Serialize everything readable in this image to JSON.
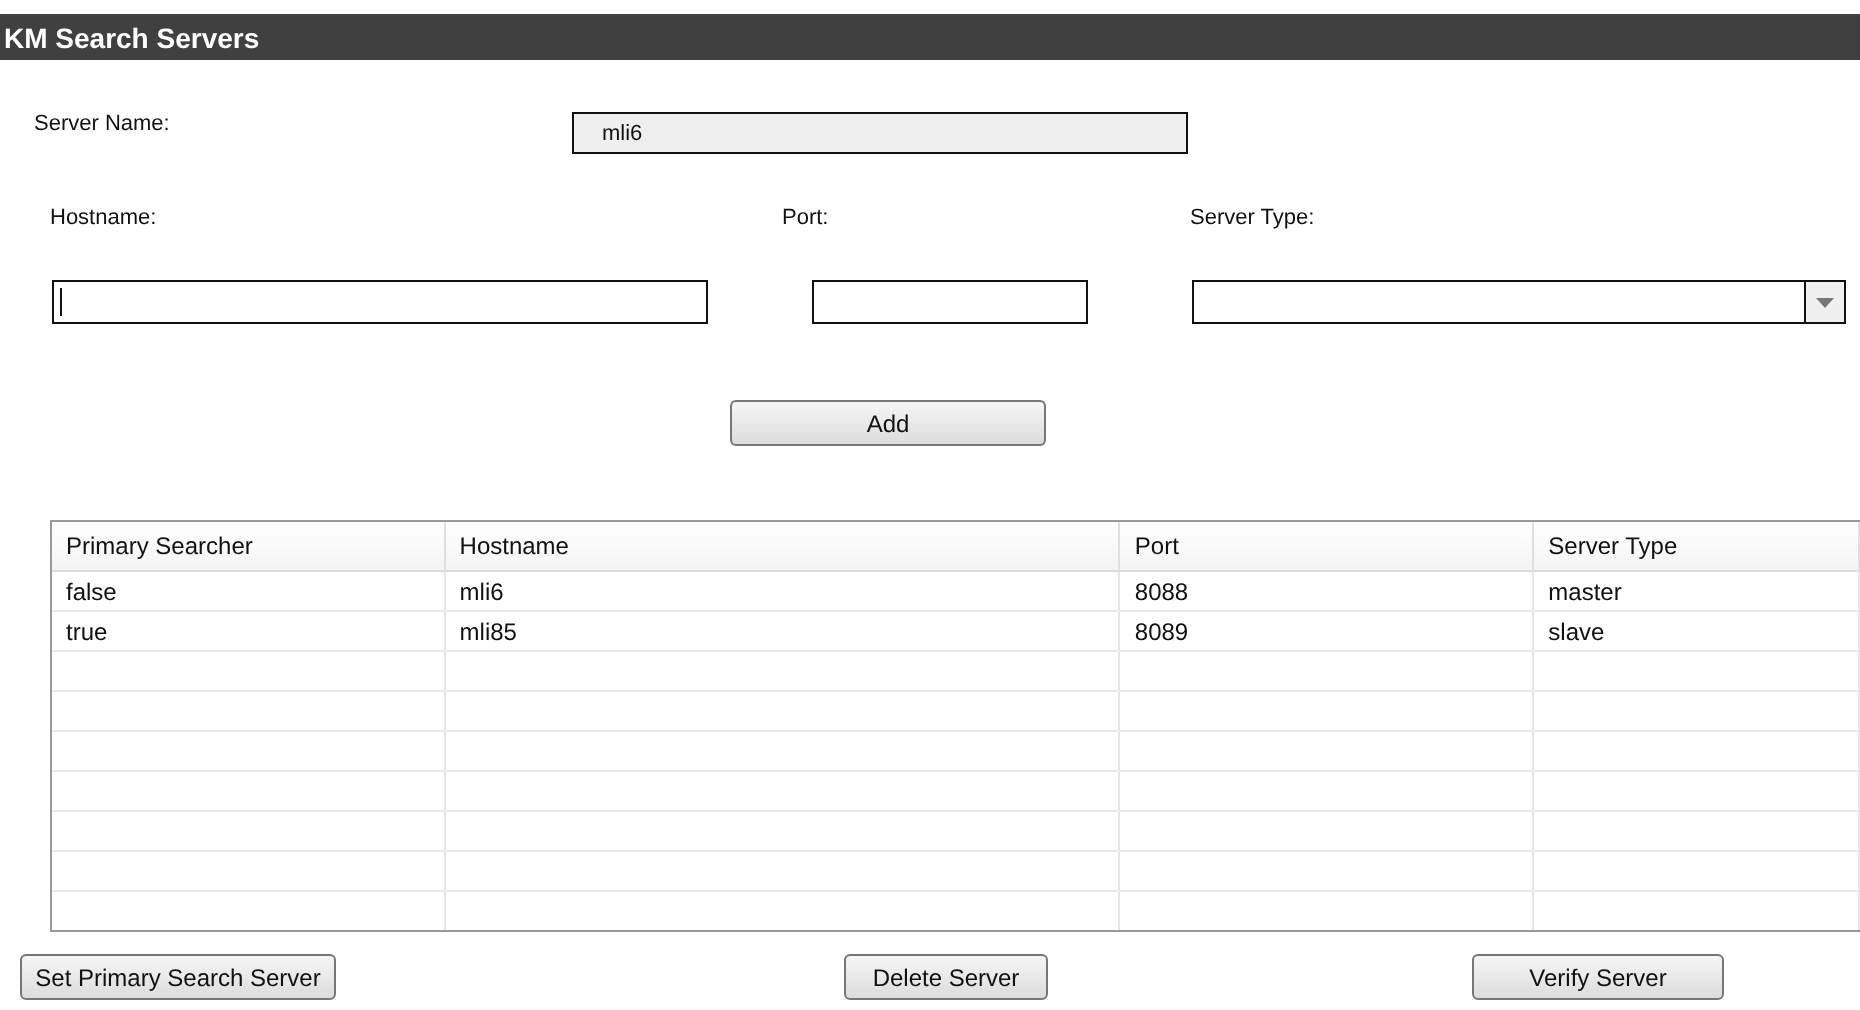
{
  "window": {
    "title": "KM Search Servers"
  },
  "server_name": {
    "label": "Server Name:",
    "value": "mli6",
    "disabled": true
  },
  "fields": [
    {
      "kind": "text",
      "label": "Hostname:",
      "focused": true
    },
    {
      "kind": "text",
      "label": "Port:",
      "focused": false
    },
    {
      "kind": "dropdown",
      "label": "Server Type:"
    }
  ],
  "add_button": "Add",
  "table": {
    "columns": [
      "Primary Searcher",
      "Hostname",
      "Port",
      "Server Type"
    ],
    "rows": [
      [
        "false",
        "mli6",
        "8088",
        "master"
      ],
      [
        "true",
        "mli85",
        "8089",
        "slave"
      ]
    ]
  },
  "buttons": [
    "Set Primary Search Server",
    "Delete Server",
    "Verify Server"
  ]
}
